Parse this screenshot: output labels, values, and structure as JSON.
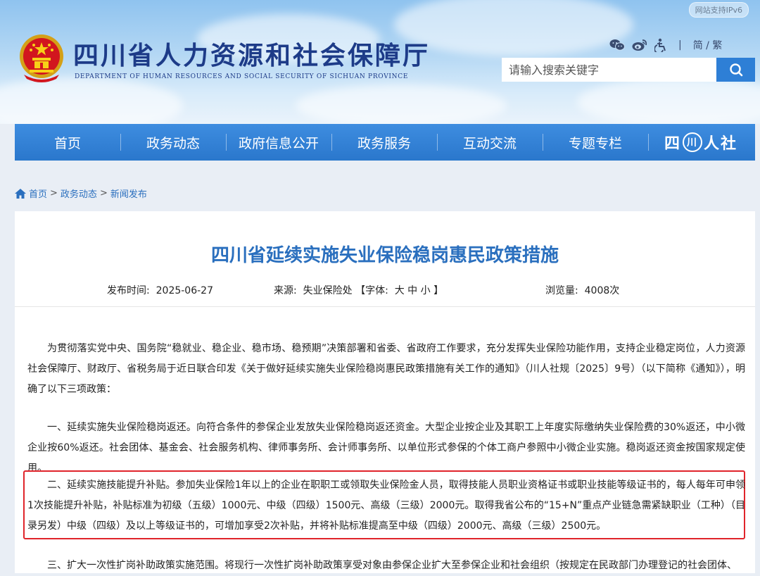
{
  "header": {
    "ipv6_badge": "网站支持IPv6",
    "site_title": "四川省人力资源和社会保障厅",
    "site_subtitle": "DEPARTMENT OF HUMAN RESOURCES AND SOCIAL SECURITY OF SICHUAN PROVINCE",
    "tools": {
      "icons": [
        "wechat-icon",
        "weibo-icon",
        "accessibility-icon"
      ],
      "lang_label": "简 / 繁"
    },
    "search": {
      "placeholder": "请输入搜索关键字",
      "value": ""
    }
  },
  "nav": {
    "items": [
      "首页",
      "政务动态",
      "政府信息公开",
      "政务服务",
      "互动交流",
      "专题专栏"
    ],
    "brand_left": "四",
    "brand_circle": "川",
    "brand_right": "人社"
  },
  "breadcrumb": [
    "首页",
    "政务动态",
    "新闻发布"
  ],
  "article": {
    "title": "四川省延续实施失业保险稳岗惠民政策措施",
    "meta": {
      "date_label": "发布时间:",
      "date": "2025-06-27",
      "source_label": "来源:",
      "source": "失业保险处",
      "font_open": "【字体:",
      "font_large": "大",
      "font_medium": "中",
      "font_small": "小",
      "font_close": "】",
      "views_label": "浏览量:",
      "views": "4008次"
    },
    "paragraphs": [
      "为贯彻落实党中央、国务院“稳就业、稳企业、稳市场、稳预期”决策部署和省委、省政府工作要求，充分发挥失业保险功能作用，支持企业稳定岗位，人力资源社会保障厅、财政厅、省税务局于近日联合印发《关于做好延续实施失业保险稳岗惠民政策措施有关工作的通知》（川人社规〔2025〕9号）（以下简称《通知》），明确了以下三项政策：",
      "一、延续实施失业保险稳岗返还。向符合条件的参保企业发放失业保险稳岗返还资金。大型企业按企业及其职工上年度实际缴纳失业保险费的30%返还，中小微企业按60%返还。社会团体、基金会、社会服务机构、律师事务所、会计师事务所、以单位形式参保的个体工商户参照中小微企业实施。稳岗返还资金按国家规定使用。",
      "二、延续实施技能提升补贴。参加失业保险1年以上的企业在职职工或领取失业保险金人员，取得技能人员职业资格证书或职业技能等级证书的，每人每年可申领1次技能提升补贴，补贴标准为初级（五级）1000元、中级（四级）1500元、高级（三级）2000元。取得我省公布的“15+N”重点产业链急需紧缺职业（工种）（目录另发）中级（四级）及以上等级证书的，可增加享受2次补贴，并将补贴标准提高至中级（四级）2000元、高级（三级）2500元。",
      "三、扩大一次性扩岗补助政策实施范围。将现行一次性扩岗补助政策享受对象由参保企业扩大至参保企业和社会组织（按规定在民政部门办理登记的社会团体、"
    ]
  },
  "colors": {
    "nav_blue": "#2e7fd6",
    "title_blue": "#2a6fbe",
    "highlight_red": "#e0242b",
    "header_title": "#1d3b88"
  }
}
